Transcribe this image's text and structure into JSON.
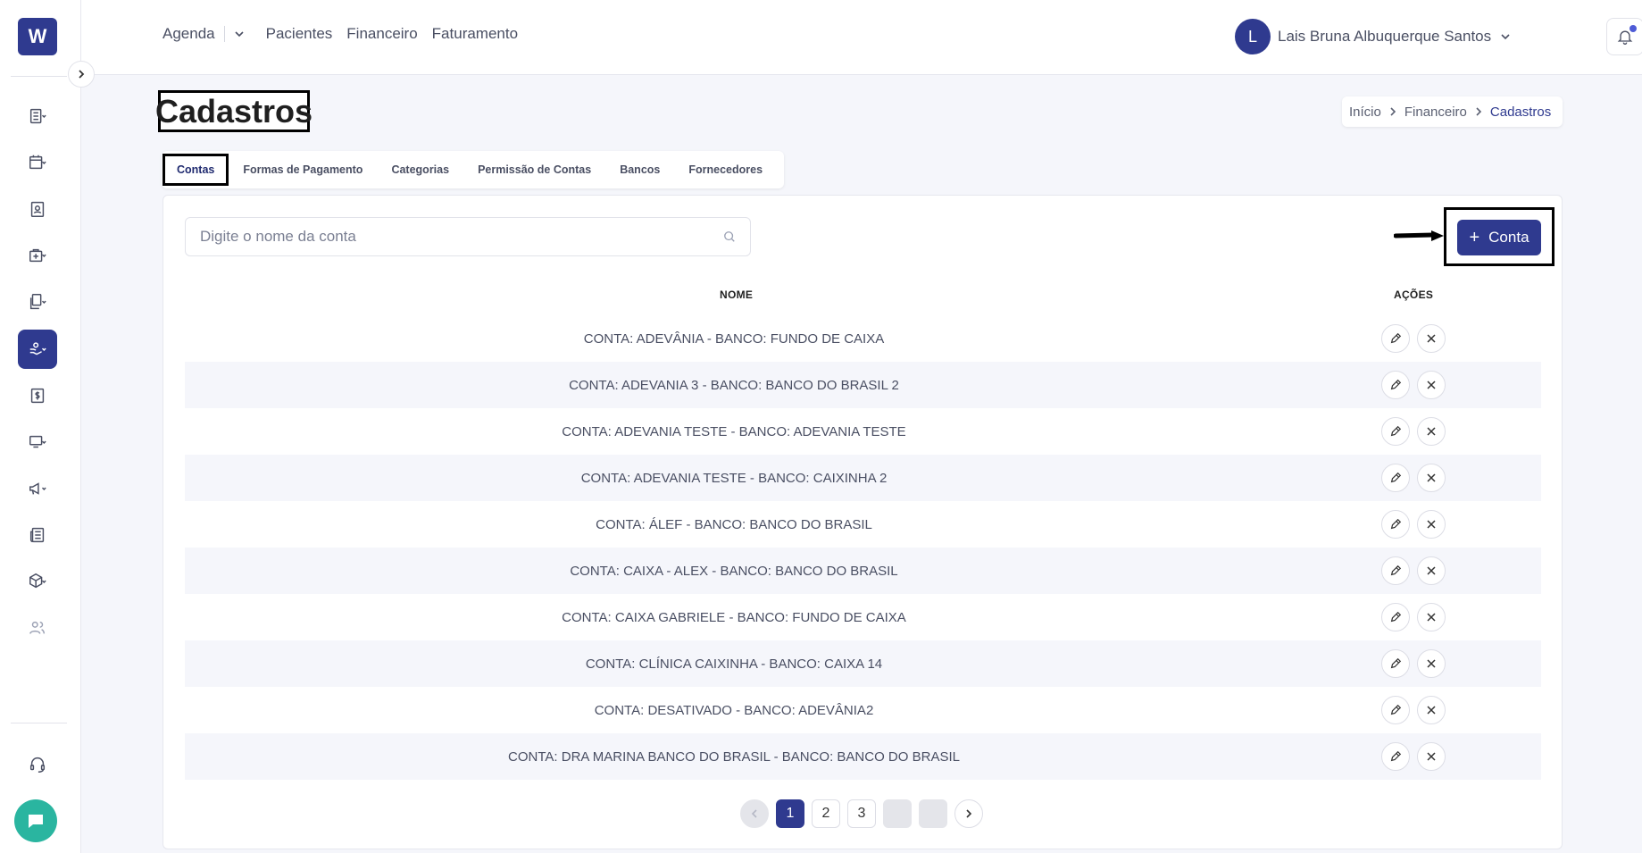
{
  "logo": {
    "letter": "W"
  },
  "topnav": {
    "items": [
      "Agenda",
      "Pacientes",
      "Financeiro",
      "Faturamento"
    ]
  },
  "user": {
    "initial": "L",
    "name": "Lais Bruna Albuquerque Santos"
  },
  "page": {
    "title": "Cadastros"
  },
  "breadcrumb": {
    "items": [
      "Início",
      "Financeiro",
      "Cadastros"
    ]
  },
  "tabs": [
    "Contas",
    "Formas de Pagamento",
    "Categorias",
    "Permissão de Contas",
    "Bancos",
    "Fornecedores"
  ],
  "search": {
    "placeholder": "Digite o nome da conta",
    "value": ""
  },
  "add_button": {
    "label": "Conta"
  },
  "table": {
    "headers": {
      "name": "NOME",
      "actions": "AÇÕES"
    },
    "rows": [
      "CONTA: ADEVÂNIA - BANCO: FUNDO DE CAIXA",
      "CONTA: ADEVANIA 3 - BANCO: BANCO DO BRASIL 2",
      "CONTA: ADEVANIA TESTE - BANCO: ADEVANIA TESTE",
      "CONTA: ADEVANIA TESTE - BANCO: CAIXINHA 2",
      "CONTA: ÁLEF - BANCO: BANCO DO BRASIL",
      "CONTA: CAIXA - ALEX - BANCO: BANCO DO BRASIL",
      "CONTA: CAIXA GABRIELE - BANCO: FUNDO DE CAIXA",
      "CONTA: CLÍNICA CAIXINHA - BANCO: CAIXA 14",
      "CONTA: DESATIVADO - BANCO: ADEVÂNIA2",
      "CONTA: DRA MARINA BANCO DO BRASIL - BANCO: BANCO DO BRASIL"
    ]
  },
  "pagination": {
    "pages": [
      "1",
      "2",
      "3"
    ],
    "current": "1"
  },
  "colors": {
    "primary": "#2f3a8f",
    "chat": "#2ab5a0",
    "notification": "#4e5bd6"
  },
  "icons": {
    "sidebar": [
      "expand-chevron-icon",
      "list-icon",
      "calendar-icon",
      "patient-badge-icon",
      "medical-bag-icon",
      "documents-icon",
      "finance-hand-icon",
      "dollar-icon",
      "monitor-icon",
      "megaphone-icon",
      "newspaper-icon",
      "package-icon",
      "users-icon",
      "headset-icon",
      "chat-icon"
    ]
  }
}
